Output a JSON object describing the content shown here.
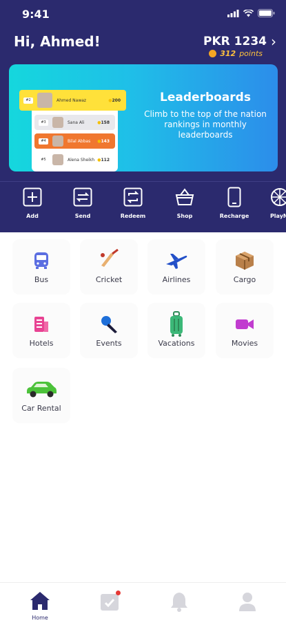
{
  "status_bar": {
    "time": "9:41"
  },
  "header": {
    "greeting": "Hi, Ahmed!",
    "balance": "PKR 1234",
    "points_value": "312",
    "points_label": "points"
  },
  "banner": {
    "title": "Leaderboards",
    "subtitle": "Climb to the top of the nation rankings in monthly leaderboards",
    "rows": [
      {
        "rank": "#2",
        "name": "Ahmed Nawaz",
        "score": "200"
      },
      {
        "rank": "#3",
        "name": "Sana Ali",
        "score": "158"
      },
      {
        "rank": "#4",
        "name": "Bilal Abbas",
        "score": "143"
      },
      {
        "rank": "#5",
        "name": "Alena Sheikh",
        "score": "112"
      }
    ]
  },
  "actions": [
    {
      "label": "Add",
      "icon": "plus-square-icon"
    },
    {
      "label": "Send",
      "icon": "transfer-icon"
    },
    {
      "label": "Redeem",
      "icon": "redeem-icon"
    },
    {
      "label": "Shop",
      "icon": "basket-icon"
    },
    {
      "label": "Recharge",
      "icon": "phone-icon"
    },
    {
      "label": "PlayN'",
      "icon": "wheel-icon"
    }
  ],
  "services": [
    {
      "label": "Bus",
      "icon": "bus-icon",
      "color": "#5b6ee1"
    },
    {
      "label": "Cricket",
      "icon": "cricket-bat-icon",
      "color": "#e07a2e"
    },
    {
      "label": "Airlines",
      "icon": "airplane-icon",
      "color": "#2350c8"
    },
    {
      "label": "Cargo",
      "icon": "cargo-box-icon",
      "color": "#8b5a2b"
    },
    {
      "label": "Hotels",
      "icon": "hotel-icon",
      "color": "#e84393"
    },
    {
      "label": "Events",
      "icon": "microphone-icon",
      "color": "#1e6fd9"
    },
    {
      "label": "Vacations",
      "icon": "luggage-icon",
      "color": "#3cb878"
    },
    {
      "label": "Movies",
      "icon": "video-camera-icon",
      "color": "#c13ccf"
    },
    {
      "label": "Car Rental",
      "icon": "car-icon",
      "color": "#4cc23a"
    }
  ],
  "bottom_nav": [
    {
      "label": "Home",
      "icon": "home-icon",
      "active": true
    },
    {
      "label": "",
      "icon": "calendar-check-icon",
      "active": false
    },
    {
      "label": "",
      "icon": "bell-icon",
      "active": false
    },
    {
      "label": "",
      "icon": "user-icon",
      "active": false
    }
  ],
  "colors": {
    "header_bg": "#2b2a6e",
    "accent_gold": "#ffc23d"
  }
}
